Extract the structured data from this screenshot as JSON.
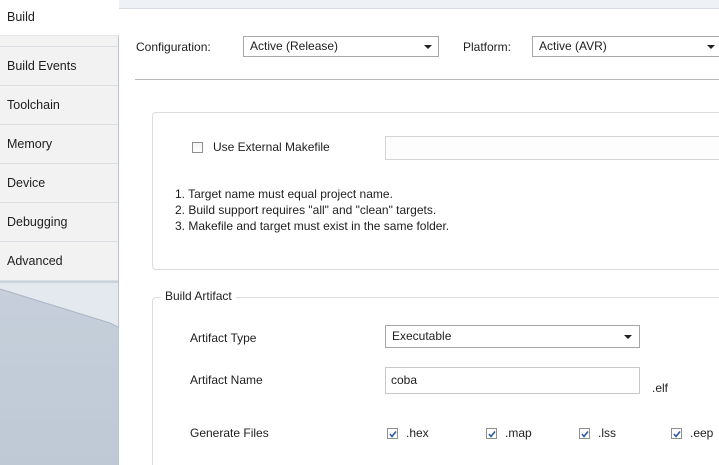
{
  "tabs": [
    {
      "label": "Build",
      "active": true
    },
    {
      "label": "Build Events",
      "active": false
    },
    {
      "label": "Toolchain",
      "active": false
    },
    {
      "label": "Memory",
      "active": false
    },
    {
      "label": "Device",
      "active": false
    },
    {
      "label": "Debugging",
      "active": false
    },
    {
      "label": "Advanced",
      "active": false
    }
  ],
  "config_bar": {
    "configuration_label": "Configuration:",
    "configuration_value": "Active (Release)",
    "platform_label": "Platform:",
    "platform_value": "Active (AVR)"
  },
  "makefile": {
    "use_external_label": "Use External Makefile",
    "use_external_checked": false,
    "path_value": "",
    "notes": [
      "1. Target name must equal project name.",
      "2. Build support requires \"all\" and \"clean\" targets.",
      "3. Makefile and target must exist in the same folder."
    ]
  },
  "build_artifact": {
    "group_title": "Build Artifact",
    "artifact_type_label": "Artifact Type",
    "artifact_type_value": "Executable",
    "artifact_name_label": "Artifact Name",
    "artifact_name_value": "coba",
    "artifact_name_ext": ".elf",
    "generate_files_label": "Generate Files",
    "generate_files": [
      {
        "label": ".hex",
        "checked": true
      },
      {
        "label": ".map",
        "checked": true
      },
      {
        "label": ".lss",
        "checked": true
      },
      {
        "label": ".eep",
        "checked": true
      }
    ]
  },
  "colors": {
    "tab_strip_bg": "#c9d3de",
    "tab_bg": "#f2f2f2",
    "active_tab_bg": "#ffffff",
    "checkmark": "#2b5aa8"
  },
  "icons": {
    "combo_arrow": "chevron-down-icon",
    "checkbox_check": "checkmark-icon"
  }
}
